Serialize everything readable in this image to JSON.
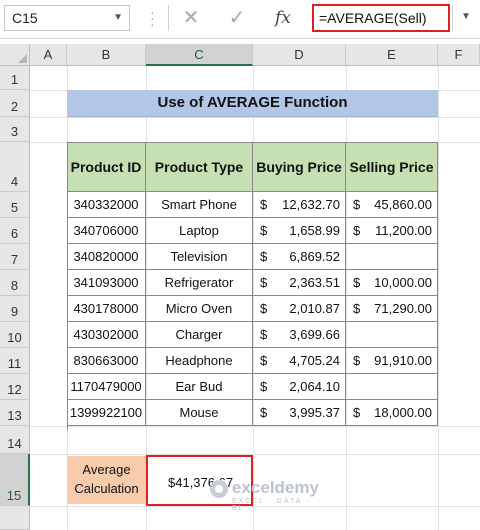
{
  "formula_bar": {
    "name_box": "C15",
    "cancel_icon": "✕",
    "enter_icon": "✓",
    "function_icon": "fx",
    "formula": "=AVERAGE(Sell)"
  },
  "columns": [
    "A",
    "B",
    "C",
    "D",
    "E",
    "F"
  ],
  "rows": [
    "1",
    "2",
    "3",
    "4",
    "5",
    "6",
    "7",
    "8",
    "9",
    "10",
    "11",
    "12",
    "13",
    "14",
    "15"
  ],
  "title": "Use of AVERAGE Function",
  "table": {
    "headers": [
      "Product ID",
      "Product Type",
      "Buying Price",
      "Selling Price"
    ],
    "rows": [
      {
        "id": "340332000",
        "type": "Smart Phone",
        "buy": "12,632.70",
        "sell": "45,860.00"
      },
      {
        "id": "340706000",
        "type": "Laptop",
        "buy": "1,658.99",
        "sell": "11,200.00"
      },
      {
        "id": "340820000",
        "type": "Television",
        "buy": "6,869.52",
        "sell": ""
      },
      {
        "id": "341093000",
        "type": "Refrigerator",
        "buy": "2,363.51",
        "sell": "10,000.00"
      },
      {
        "id": "430178000",
        "type": "Micro Oven",
        "buy": "2,010.87",
        "sell": "71,290.00"
      },
      {
        "id": "430302000",
        "type": "Charger",
        "buy": "3,699.66",
        "sell": ""
      },
      {
        "id": "830663000",
        "type": "Headphone",
        "buy": "4,705.24",
        "sell": "91,910.00"
      },
      {
        "id": "1170479000",
        "type": "Ear Bud",
        "buy": "2,064.10",
        "sell": ""
      },
      {
        "id": "1399922100",
        "type": "Mouse",
        "buy": "3,995.37",
        "sell": "18,000.00"
      }
    ],
    "currency": "$"
  },
  "average": {
    "label_line1": "Average",
    "label_line2": "Calculation",
    "value": "$41,376.67"
  },
  "watermark": {
    "name": "exceldemy",
    "tagline": "EXCEL · DATA · BI"
  },
  "colors": {
    "title_bg": "#b4c6e7",
    "header_bg": "#c6e0b4",
    "label_bg": "#f8cbad",
    "highlight_border": "#e02020"
  }
}
